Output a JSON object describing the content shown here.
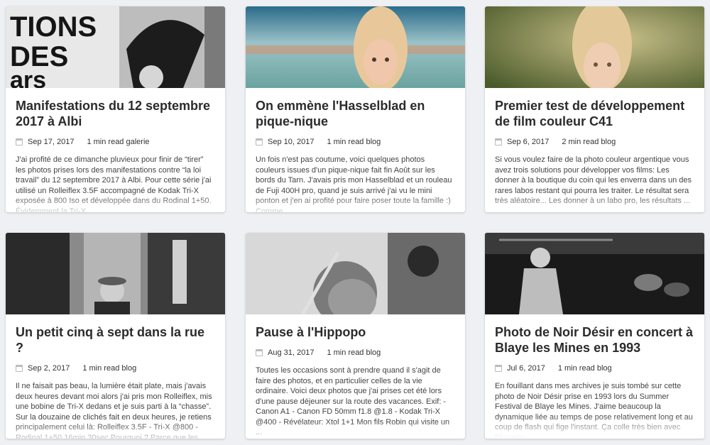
{
  "posts": [
    {
      "title": "Manifestations du 12 septembre 2017 à Albi",
      "date": "Sep 17, 2017",
      "readtime": "1 min read",
      "category": "galerie",
      "excerpt": "J'ai profité de ce dimanche pluvieux pour finir de “tirer” les photos prises lors des manifestations contre “la loi travail” du 12 septembre 2017 à Albi. Pour cette série j'ai utilisé un Rolleiflex 3.5F accompagné de Kodak Tri-X exposée à 800 Iso et développée dans du Rodinal 1+50. Évidemment la Tri-X ...",
      "thumb": "protest-photo-bw"
    },
    {
      "title": "On emmène l'Hasselblad en pique-nique",
      "date": "Sep 10, 2017",
      "readtime": "1 min read",
      "category": "blog",
      "excerpt": "Un fois n'est pas coutume, voici quelques photos couleurs issues d'un pique-nique fait fin Août sur les bords du Tarn. J'avais pris mon Hasselblad et un rouleau de Fuji 400H pro, quand je suis arrivé j'ai vu le mini ponton et j'en ai profité pour faire poser toute la famille :) Comme ...",
      "thumb": "girl-lake-photo"
    },
    {
      "title": "Premier test de développement de film couleur C41",
      "date": "Sep 6, 2017",
      "readtime": "2 min read",
      "category": "blog",
      "excerpt": "Si vous voulez faire de la photo couleur argentique vous avez trois solutions pour développer vos films: Les donner à la boutique du coin qui les enverra dans un des rares labos restant qui pourra les traiter. Le résultat sera très aléatoire... Les donner à un labo pro, les résultats ...",
      "thumb": "girl-sunlight-photo"
    },
    {
      "title": "Un petit cinq à sept dans la rue ?",
      "date": "Sep 2, 2017",
      "readtime": "1 min read",
      "category": "blog",
      "excerpt": "Il ne faisait pas beau, la lumière était plate, mais j'avais deux heures devant moi alors j'ai pris mon Rolleiflex, mis une bobine de Tri-X dedans et je suis parti à la “chasse”. Sur la douzaine de clichés fait en deux heures, je retiens principalement celui là: Rolleiflex 3.5F - Tri-X @800 - Rodinal 1+50 16min 30sec Pourquoi ? Parce que les ...",
      "thumb": "street-man-photo-bw"
    },
    {
      "title": "Pause à l'Hippopo",
      "date": "Aug 31, 2017",
      "readtime": "1 min read",
      "category": "blog",
      "excerpt": "Toutes les occasions sont à prendre quand il s'agit de faire des photos, et en particulier celles de la vie ordinaire. Voici deux photos que j'ai prises cet été lors d'une pause déjeuner sur la route des vacances. Exif: - Canon A1 - Canon FD 50mm f1.8 @1.8 - Kodak Tri-X @400 - Révélateur: Xtol 1+1 Mon fils Robin qui visite un ...",
      "thumb": "boy-straw-photo-bw"
    },
    {
      "title": "Photo de Noir Désir en concert à Blaye les Mines en 1993",
      "date": "Jul 6, 2017",
      "readtime": "1 min read",
      "category": "blog",
      "excerpt": "En fouillant dans mes archives je suis tombé sur cette photo de Noir Désir prise en 1993 lors du Summer Festival de Blaye les Mines. J'aime beaucoup la dynamique liée au temps de pose relativement long et au coup de flash qui fige l'instant. Ça colle très bien avec l'énergie ...",
      "thumb": "concert-photo-bw"
    }
  ]
}
